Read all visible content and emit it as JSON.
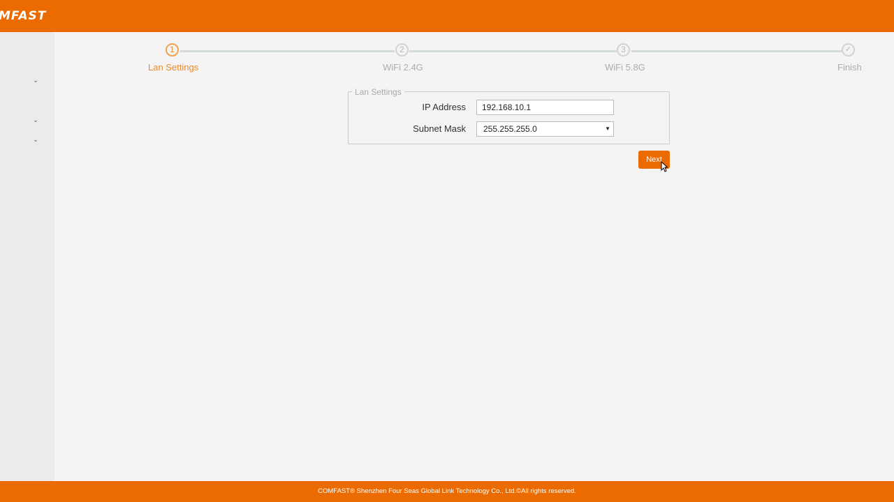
{
  "header": {
    "logo_text": "MFAST",
    "brand_color": "#ec6b00"
  },
  "sidebar": {
    "chevrons": [
      "chevron-down-icon",
      "chevron-down-icon",
      "chevron-down-icon"
    ]
  },
  "stepper": {
    "steps": [
      {
        "number": "1",
        "label": "Lan Settings",
        "state": "active"
      },
      {
        "number": "2",
        "label": "WiFi 2.4G",
        "state": "pending"
      },
      {
        "number": "3",
        "label": "WiFi 5.8G",
        "state": "pending"
      },
      {
        "number": "✓",
        "label": "Finish",
        "state": "pending",
        "icon": "check-icon"
      }
    ],
    "active_color": "#ec8a2b"
  },
  "form": {
    "legend": "Lan Settings",
    "ip_label": "IP Address",
    "ip_value": "192.168.10.1",
    "subnet_label": "Subnet Mask",
    "subnet_value": "255.255.255.0",
    "subnet_arrow": "▼"
  },
  "actions": {
    "next_label": "Next"
  },
  "footer": {
    "copyright": "COMFAST® Shenzhen Four Seas Global Link Technology Co., Ltd.©All rights reserved."
  }
}
